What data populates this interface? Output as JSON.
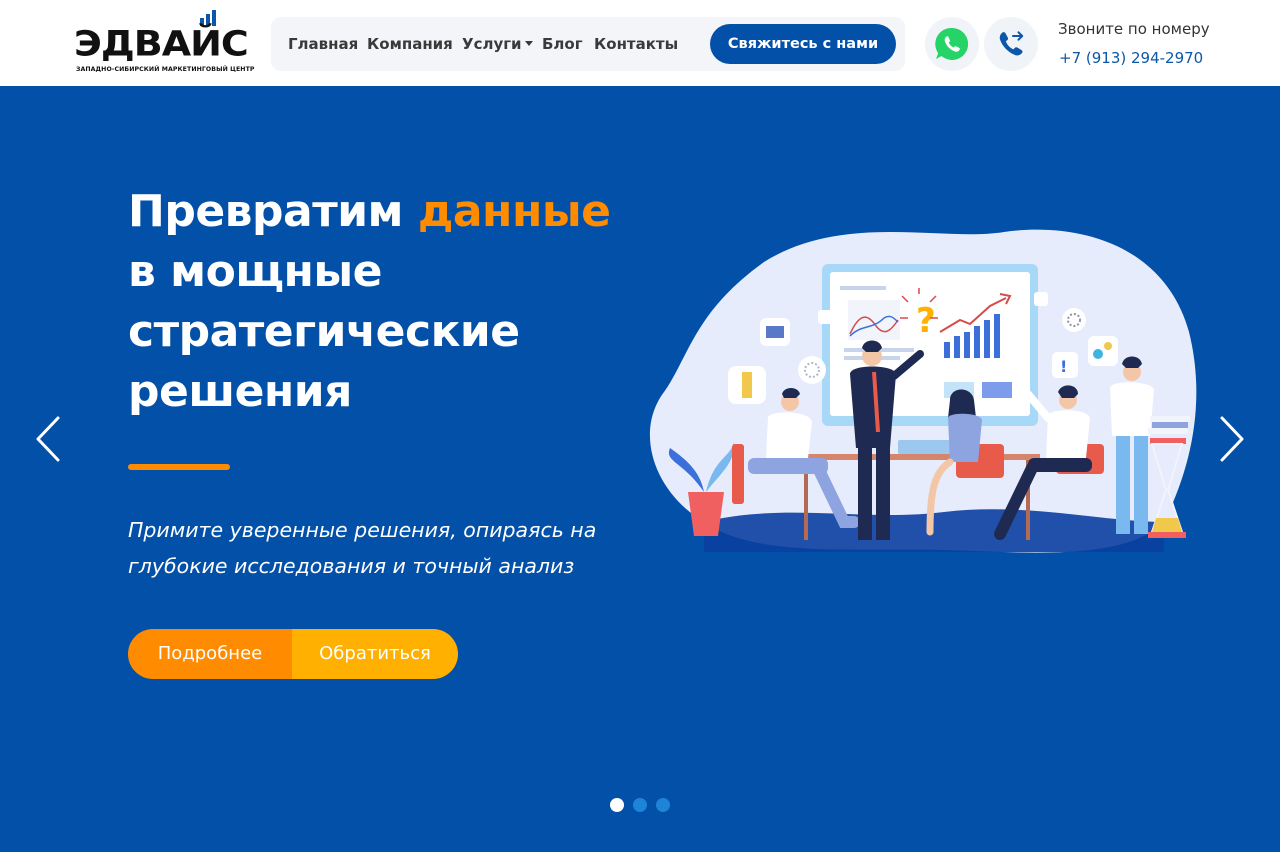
{
  "header": {
    "logo": {
      "wordmark": "ЭДВАЙС",
      "subtitle": "ЗАПАДНО-СИБИРСКИЙ МАРКЕТИНГОВЫЙ ЦЕНТР"
    },
    "nav": [
      {
        "label": "Главная"
      },
      {
        "label": "Компания"
      },
      {
        "label": "Услуги",
        "has_dropdown": true
      },
      {
        "label": "Блог"
      },
      {
        "label": "Контакты"
      }
    ],
    "cta_label": "Свяжитесь с нами",
    "whatsapp_icon": "whatsapp-icon",
    "call_icon": "phone-forward-icon",
    "call_label": "Звоните по номеру",
    "phone": "+7 (913) 294-2970"
  },
  "hero": {
    "title_before": "Превратим ",
    "title_accent": "данные",
    "title_after": "в мощные стратегические решения",
    "subtitle": "Примите уверенные решения, опираясь на глубокие исследования и точный анализ",
    "btn_more": "Подробнее",
    "btn_apply": "Обратиться",
    "slides": [
      {
        "active": true
      },
      {
        "active": false
      },
      {
        "active": false
      }
    ]
  },
  "colors": {
    "brand_blue": "#0250a8",
    "accent_orange": "#ff8c00",
    "accent_yellow": "#ffb000",
    "whatsapp_green": "#25d366"
  }
}
